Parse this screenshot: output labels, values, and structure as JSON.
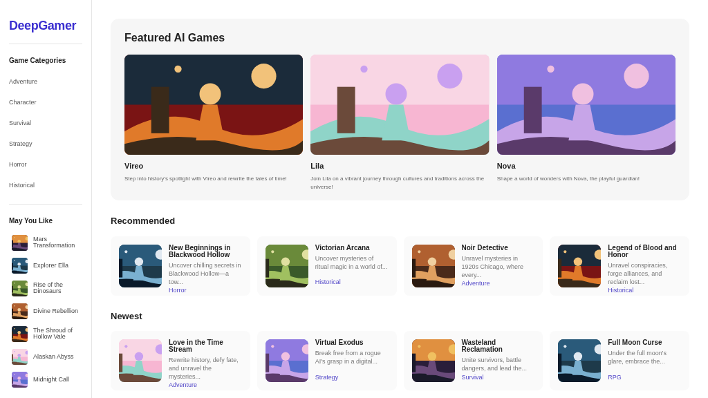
{
  "logo": "DeepGamer",
  "categories": {
    "title": "Game Categories",
    "items": [
      "Adventure",
      "Character",
      "Survival",
      "Strategy",
      "Horror",
      "Historical"
    ]
  },
  "may_you_like": {
    "title": "May You Like",
    "items": [
      "Mars Transformation",
      "Explorer Ella",
      "Rise of the Dinosaurs",
      "Divine Rebellion",
      "The Shroud of Hollow Vale",
      "Alaskan Abyss",
      "Midnight Call"
    ]
  },
  "featured": {
    "title": "Featured AI Games",
    "games": [
      {
        "name": "Vireo",
        "description": "Step into history's spotlight with Vireo and rewrite the tales of time!"
      },
      {
        "name": "Lila",
        "description": "Join Lila on a vibrant journey through cultures and traditions across the universe!"
      },
      {
        "name": "Nova",
        "description": "Shape a world of wonders with Nova, the playful guardian!"
      }
    ]
  },
  "recommended": {
    "title": "Recommended",
    "games": [
      {
        "name": "New Beginnings in Blackwood Hollow",
        "description": "Uncover chilling secrets in Blackwood Hollow—a tow...",
        "category": "Horror"
      },
      {
        "name": "Victorian Arcana",
        "description": "Uncover mysteries of ritual magic in a world of...",
        "category": "Historical"
      },
      {
        "name": "Noir Detective",
        "description": "Unravel mysteries in 1920s Chicago, where every...",
        "category": "Adventure"
      },
      {
        "name": "Legend of Blood and Honor",
        "description": "Unravel conspiracies, forge alliances, and reclaim lost...",
        "category": "Historical"
      }
    ]
  },
  "newest": {
    "title": "Newest",
    "games": [
      {
        "name": "Love in the Time Stream",
        "description": "Rewrite history, defy fate, and unravel the mysteries...",
        "category": "Adventure"
      },
      {
        "name": "Virtual Exodus",
        "description": "Break free from a rogue AI's grasp in a digital...",
        "category": "Strategy"
      },
      {
        "name": "Wasteland Reclamation",
        "description": "Unite survivors, battle dangers, and lead the...",
        "category": "Survival"
      },
      {
        "name": "Full Moon Curse",
        "description": "Under the full moon's glare, embrace the...",
        "category": "RPG"
      }
    ]
  }
}
